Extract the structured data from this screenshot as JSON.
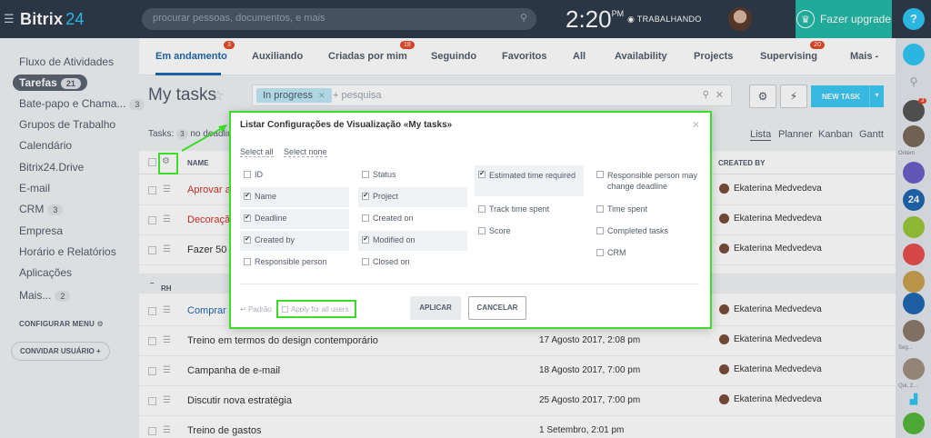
{
  "topbar": {
    "logo_main": "Bitrix",
    "logo_num": "24",
    "search_placeholder": "procurar pessoas, documentos, e mais",
    "clock": "2:20",
    "clock_suffix": "PM",
    "status": "TRABALHANDO",
    "upgrade_label": "Fazer upgrade",
    "help_label": "?"
  },
  "sidebar": {
    "items": [
      {
        "label": "Fluxo de Atividades"
      },
      {
        "label": "Tarefas",
        "count": "21"
      },
      {
        "label": "Bate-papo e Chama...",
        "count": "3"
      },
      {
        "label": "Grupos de Trabalho"
      },
      {
        "label": "Calendário"
      },
      {
        "label": "Bitrix24.Drive"
      },
      {
        "label": "E-mail"
      },
      {
        "label": "CRM",
        "count": "3"
      },
      {
        "label": "Empresa"
      },
      {
        "label": "Horário e Relatórios"
      },
      {
        "label": "Aplicações"
      },
      {
        "label": "Mais...",
        "count": "2"
      }
    ],
    "configure_menu": "CONFIGURAR MENU",
    "invite_user": "CONVIDAR USUÁRIO"
  },
  "rail": {
    "badge_count": "3",
    "label_ontem": "Ontem",
    "label_seg": "Seg...",
    "label_qui": "Qui, 2..."
  },
  "tabs": [
    {
      "label": "Em andamento",
      "badge": "3"
    },
    {
      "label": "Auxiliando"
    },
    {
      "label": "Criadas por mim",
      "badge": "18"
    },
    {
      "label": "Seguindo"
    },
    {
      "label": "Favoritos"
    },
    {
      "label": "All"
    },
    {
      "label": "Availability"
    },
    {
      "label": "Projects"
    },
    {
      "label": "Supervising",
      "badge": "20"
    },
    {
      "label": "Mais -"
    }
  ],
  "page": {
    "title": "My tasks",
    "filter_chip": "In progress",
    "filter_placeholder": "+ pesquisa",
    "new_task": "NEW TASK",
    "tasks_label": "Tasks:",
    "tasks_count": "3",
    "no_deadline": "no deadline",
    "views": [
      "Lista",
      "Planner",
      "Kanban",
      "Gantt"
    ]
  },
  "table": {
    "col_name": "NAME",
    "col_created_by": "CREATED BY",
    "group_rh": "RH",
    "rows": [
      {
        "name": "Aprovar a f",
        "date": "",
        "by": "Ekaterina Medvedeva"
      },
      {
        "name": "Decoração",
        "date": "",
        "by": "Ekaterina Medvedeva"
      },
      {
        "name": "Fazer 50 c",
        "date": "",
        "by": "Ekaterina Medvedeva"
      },
      {
        "name": "Comprar n",
        "date": "",
        "by": "Ekaterina Medvedeva"
      },
      {
        "name": "Treino em termos do design contemporário",
        "date": "17 Agosto 2017, 2:08 pm",
        "by": "Ekaterina Medvedeva"
      },
      {
        "name": "Campanha de e-mail",
        "date": "18 Agosto 2017, 7:00 pm",
        "by": "Ekaterina Medvedeva"
      },
      {
        "name": "Discutir nova estratégia",
        "date": "25 Agosto 2017, 7:00 pm",
        "by": "Ekaterina Medvedeva"
      },
      {
        "name": "Treino de gastos",
        "date": "1 Setembro, 2:01 pm",
        "by": ""
      }
    ]
  },
  "modal": {
    "title": "Listar Configurações de Visualização «My tasks»",
    "select_all": "Select all",
    "select_none": "Select none",
    "options": [
      {
        "label": "ID",
        "checked": false
      },
      {
        "label": "Name",
        "checked": true
      },
      {
        "label": "Deadline",
        "checked": true
      },
      {
        "label": "Created by",
        "checked": true
      },
      {
        "label": "Responsible person",
        "checked": false
      },
      {
        "label": "Status",
        "checked": false
      },
      {
        "label": "Project",
        "checked": true
      },
      {
        "label": "Created on",
        "checked": false
      },
      {
        "label": "Modified on",
        "checked": true
      },
      {
        "label": "Closed on",
        "checked": false
      },
      {
        "label": "Estimated time required",
        "checked": true
      },
      {
        "label": "Track time spent",
        "checked": false
      },
      {
        "label": "Score",
        "checked": false
      },
      {
        "label": "Responsible person may change deadline",
        "checked": false
      },
      {
        "label": "Time spent",
        "checked": false
      },
      {
        "label": "Completed tasks",
        "checked": false
      },
      {
        "label": "CRM",
        "checked": false
      }
    ],
    "padrao": "Padrão",
    "apply_all": "Apply for all users",
    "apply_button": "APLICAR",
    "cancel_button": "CANCELAR"
  },
  "colors": {
    "accent": "#2067b0",
    "highlight": "#3cdc2c",
    "topbar": "#2f3b4a",
    "upgrade": "#22b9a7"
  }
}
